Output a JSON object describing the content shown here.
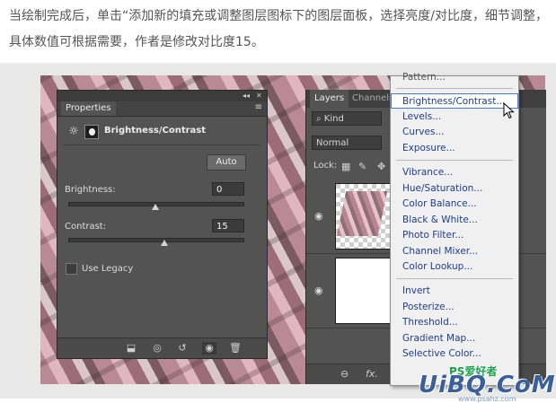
{
  "caption": "当绘制完成后，单击“添加新的填充或调整图层图标下的图层面板，选择亮度/对比度，细节调整，具体数值可根据需要，作者是修改对比度15。",
  "properties_panel": {
    "tab": "Properties",
    "collapse_glyph": "◂◂",
    "close_glyph": "✕",
    "menu_glyph": "≡",
    "title": "Brightness/Contrast",
    "auto_label": "Auto",
    "brightness_label": "Brightness:",
    "brightness_value": "0",
    "contrast_label": "Contrast:",
    "contrast_value": "15",
    "legacy_label": "Use Legacy",
    "slider_range": [
      -150,
      150
    ],
    "brightness_slider": 0,
    "contrast_slider": 15,
    "bottom_icons": [
      "clip-to-layer-icon",
      "view-previous-icon",
      "reset-icon",
      "visibility-icon",
      "delete-icon"
    ]
  },
  "layers_panel": {
    "tabs": [
      "Layers",
      "Channels"
    ],
    "kind_label": "Kind",
    "blend_mode": "Normal",
    "lock_label": "Lock:",
    "layers": [
      {
        "name": "text-layer",
        "thumbnail": "checker"
      },
      {
        "name": "background-layer",
        "thumbnail": "white"
      }
    ],
    "bottom_icons": [
      "link-icon",
      "fx-icon",
      "mask-icon",
      "adjustment-icon",
      "folder-icon"
    ],
    "fx_label": "fx."
  },
  "adjustment_menu": {
    "partial_top_item": "Pattern...",
    "highlighted": "Brightness/Contrast...",
    "group1": [
      "Brightness/Contrast...",
      "Levels...",
      "Curves...",
      "Exposure..."
    ],
    "group2": [
      "Vibrance...",
      "Hue/Saturation...",
      "Color Balance...",
      "Black & White...",
      "Photo Filter...",
      "Channel Mixer...",
      "Color Lookup..."
    ],
    "group3": [
      "Invert",
      "Posterize...",
      "Threshold...",
      "Gradient Map...",
      "Selective Color..."
    ]
  },
  "watermark": {
    "site": "PS爱好者",
    "logo": "UiBQ.CoM",
    "url": "www.psahz.com"
  },
  "colors": {
    "panel_bg": "#535353",
    "menu_bg": "#f0f0f0",
    "menu_text": "#1e3c8e",
    "highlight_border": "#3e7be5"
  }
}
